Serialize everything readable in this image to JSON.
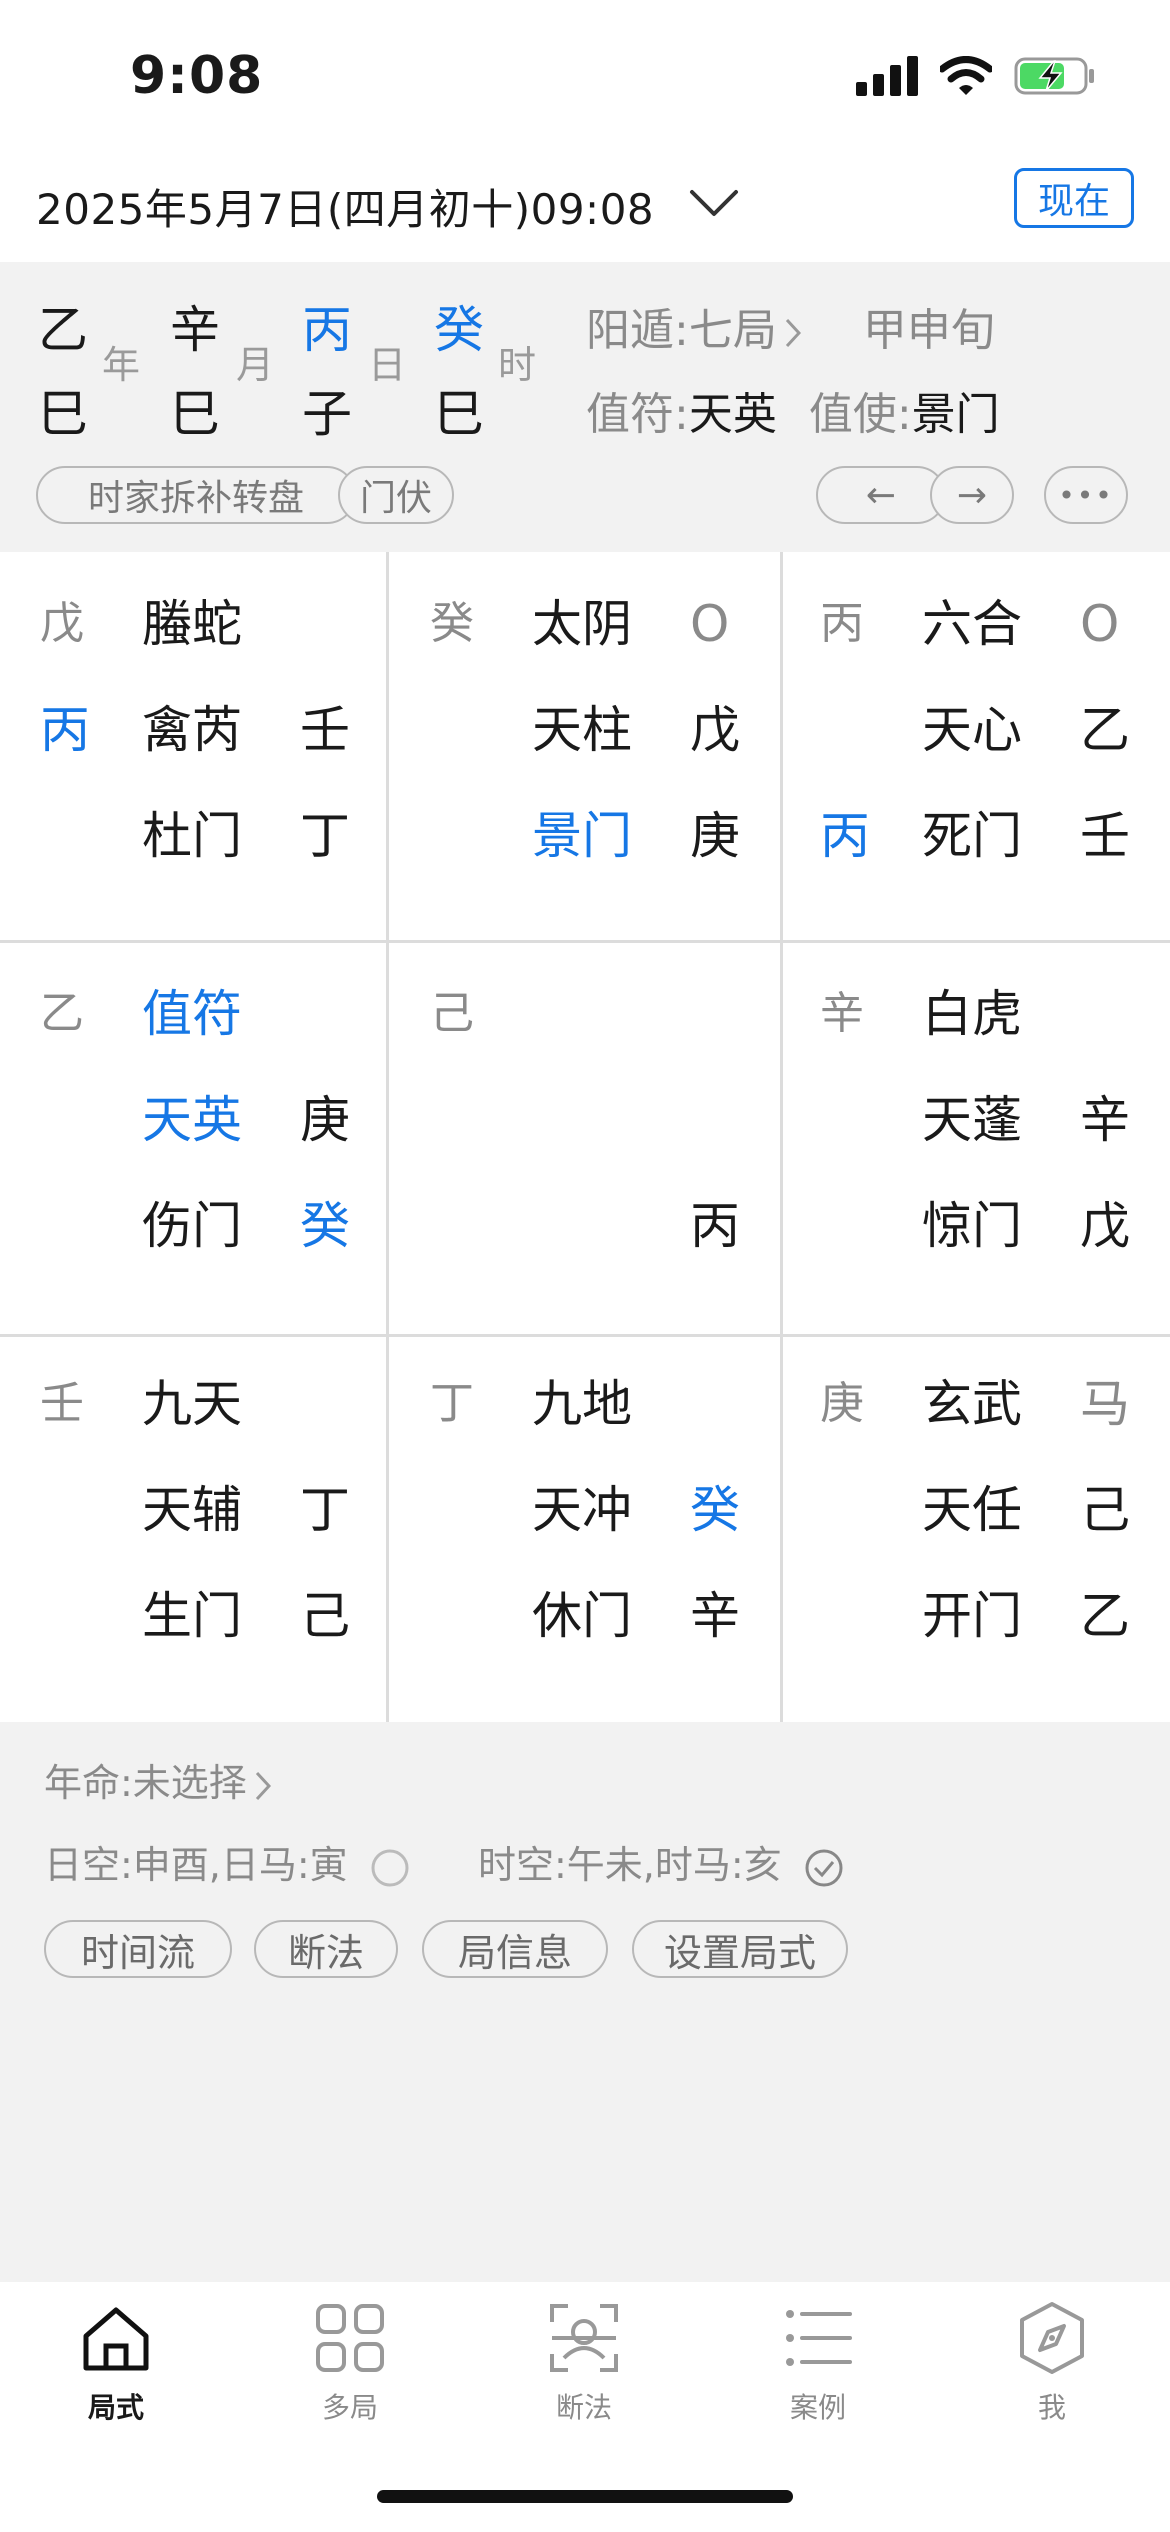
{
  "status": {
    "time": "9:08"
  },
  "header": {
    "date": "2025年5月7日(四月初十)09:08",
    "now_label": "现在"
  },
  "pillars": [
    {
      "stem": "乙",
      "branch": "巳",
      "label": "年",
      "stem_color": "#1a1a1a"
    },
    {
      "stem": "辛",
      "branch": "巳",
      "label": "月",
      "stem_color": "#1a1a1a"
    },
    {
      "stem": "丙",
      "branch": "子",
      "label": "日",
      "stem_color": "#1677e5"
    },
    {
      "stem": "癸",
      "branch": "巳",
      "label": "时",
      "stem_color": "#1677e5"
    }
  ],
  "info": {
    "ju": "阳遁:七局",
    "xun": "甲申旬",
    "zhifu_label": "值符:",
    "zhifu_value": "天英",
    "zhishi_label": "值使:",
    "zhishi_value": "景门"
  },
  "method_pills": [
    "时家拆补转盘",
    "门伏"
  ],
  "nav_arrows": {
    "prev": "←",
    "next": "→",
    "more": "•••"
  },
  "palaces": [
    {
      "corner": "戊",
      "left2": "丙",
      "left2_color": "#1677e5",
      "left3": "",
      "god": "螣蛇",
      "god_color": "#1a1a1a",
      "star": "禽芮",
      "star_color": "#1a1a1a",
      "door": "杜门",
      "door_color": "#1a1a1a",
      "r1": "",
      "r1_color": "#1a1a1a",
      "r2": "壬",
      "r2_color": "#1a1a1a",
      "r3": "丁",
      "r3_color": "#1a1a1a"
    },
    {
      "corner": "癸",
      "left2": "",
      "left2_color": "#1a1a1a",
      "left3": "",
      "god": "太阴",
      "god_color": "#1a1a1a",
      "star": "天柱",
      "star_color": "#1a1a1a",
      "door": "景门",
      "door_color": "#1677e5",
      "r1": "O",
      "r1_color": "#8a8a8a",
      "r2": "戊",
      "r2_color": "#1a1a1a",
      "r3": "庚",
      "r3_color": "#1a1a1a"
    },
    {
      "corner": "丙",
      "left2": "",
      "left2_color": "#1a1a1a",
      "left3": "丙",
      "god": "六合",
      "god_color": "#1a1a1a",
      "star": "天心",
      "star_color": "#1a1a1a",
      "door": "死门",
      "door_color": "#1a1a1a",
      "r1": "O",
      "r1_color": "#8a8a8a",
      "r2": "乙",
      "r2_color": "#1a1a1a",
      "r3": "壬",
      "r3_color": "#1a1a1a"
    },
    {
      "corner": "乙",
      "left2": "",
      "left2_color": "#1a1a1a",
      "left3": "",
      "god": "值符",
      "god_color": "#1677e5",
      "star": "天英",
      "star_color": "#1677e5",
      "door": "伤门",
      "door_color": "#1a1a1a",
      "r1": "",
      "r1_color": "#1a1a1a",
      "r2": "庚",
      "r2_color": "#1a1a1a",
      "r3": "癸",
      "r3_color": "#1677e5"
    },
    {
      "corner": "己",
      "left2": "",
      "left2_color": "#1a1a1a",
      "left3": "",
      "god": "",
      "god_color": "#1a1a1a",
      "star": "",
      "star_color": "#1a1a1a",
      "door": "",
      "door_color": "#1a1a1a",
      "r1": "",
      "r1_color": "#1a1a1a",
      "r2": "",
      "r2_color": "#1a1a1a",
      "r3": "丙",
      "r3_color": "#1a1a1a"
    },
    {
      "corner": "辛",
      "left2": "",
      "left2_color": "#1a1a1a",
      "left3": "",
      "god": "白虎",
      "god_color": "#1a1a1a",
      "star": "天蓬",
      "star_color": "#1a1a1a",
      "door": "惊门",
      "door_color": "#1a1a1a",
      "r1": "",
      "r1_color": "#1a1a1a",
      "r2": "辛",
      "r2_color": "#1a1a1a",
      "r3": "戊",
      "r3_color": "#1a1a1a"
    },
    {
      "corner": "壬",
      "left2": "",
      "left2_color": "#1a1a1a",
      "left3": "",
      "god": "九天",
      "god_color": "#1a1a1a",
      "star": "天辅",
      "star_color": "#1a1a1a",
      "door": "生门",
      "door_color": "#1a1a1a",
      "r1": "",
      "r1_color": "#1a1a1a",
      "r2": "丁",
      "r2_color": "#1a1a1a",
      "r3": "己",
      "r3_color": "#1a1a1a"
    },
    {
      "corner": "丁",
      "left2": "",
      "left2_color": "#1a1a1a",
      "left3": "",
      "god": "九地",
      "god_color": "#1a1a1a",
      "star": "天冲",
      "star_color": "#1a1a1a",
      "door": "休门",
      "door_color": "#1a1a1a",
      "r1": "",
      "r1_color": "#1a1a1a",
      "r2": "癸",
      "r2_color": "#1677e5",
      "r3": "辛",
      "r3_color": "#1a1a1a"
    },
    {
      "corner": "庚",
      "left2": "",
      "left2_color": "#1a1a1a",
      "left3": "",
      "god": "玄武",
      "god_color": "#1a1a1a",
      "star": "天任",
      "star_color": "#1a1a1a",
      "door": "开门",
      "door_color": "#1a1a1a",
      "r1": "马",
      "r1_color": "#8a8a8a",
      "r2": "己",
      "r2_color": "#1a1a1a",
      "r3": "乙",
      "r3_color": "#1a1a1a"
    }
  ],
  "lower": {
    "nianming": "年命:未选择",
    "rikong": "日空:申酉,日马:寅",
    "shikong": "时空:午未,时马:亥",
    "pills": [
      "时间流",
      "断法",
      "局信息",
      "设置局式"
    ]
  },
  "tabs": [
    {
      "label": "局式",
      "icon": "home-icon",
      "active": true
    },
    {
      "label": "多局",
      "icon": "grid-icon",
      "active": false
    },
    {
      "label": "断法",
      "icon": "scan-icon",
      "active": false
    },
    {
      "label": "案例",
      "icon": "list-icon",
      "active": false
    },
    {
      "label": "我",
      "icon": "compass-icon",
      "active": false
    }
  ]
}
